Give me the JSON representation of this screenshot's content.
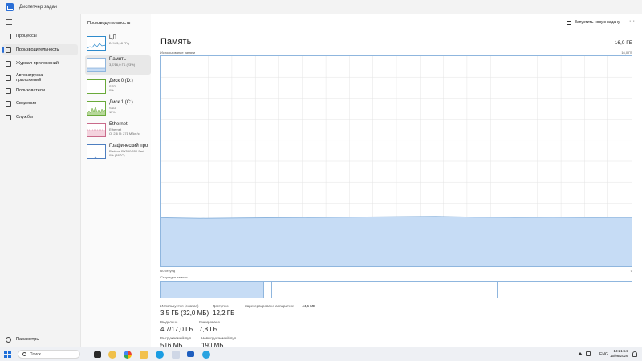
{
  "window": {
    "title": "Диспетчер задач"
  },
  "nav": {
    "items": [
      {
        "label": "Процессы"
      },
      {
        "label": "Производительность"
      },
      {
        "label": "Журнал приложений"
      },
      {
        "label": "Автозагрузка приложений"
      },
      {
        "label": "Пользователи"
      },
      {
        "label": "Сведения"
      },
      {
        "label": "Службы"
      }
    ],
    "settings": "Параметры"
  },
  "perf": {
    "header": "Производительность",
    "items": [
      {
        "name": "ЦП",
        "sub1": "24% 3,18 ГГц",
        "sub2": ""
      },
      {
        "name": "Память",
        "sub1": "3,7/16,0 ГБ (23%)",
        "sub2": ""
      },
      {
        "name": "Диск 0 (D:)",
        "sub1": "SSD",
        "sub2": "0%"
      },
      {
        "name": "Диск 1 (C:)",
        "sub1": "SSD",
        "sub2": "11%"
      },
      {
        "name": "Ethernet",
        "sub1": "Ethernet",
        "sub2": "О: 2,6 П: 271 Мбит/с"
      },
      {
        "name": "Графический про",
        "sub1": "Radeon RX550/550 Seri",
        "sub2": "0% (38 °C)"
      }
    ]
  },
  "main": {
    "run_task": "Запустить новую задачу",
    "more": "···",
    "title": "Память",
    "total": "16,0 ГБ",
    "usage_label": "Использование памяти",
    "usage_max": "16,0 ГБ",
    "axis_left": "60 секунд",
    "axis_right": "0",
    "struct_label": "Структура памяти",
    "stats": {
      "in_use_label": "Используется (сжатая)",
      "in_use_value": "3,5 ГБ (32,0 МБ)",
      "available_label": "Доступно",
      "available_value": "12,2 ГБ",
      "reserved_label": "Зарезервировано аппаратно:",
      "reserved_value": "44,6 МБ",
      "committed_label": "Выделено",
      "committed_value": "4,7/17,0 ГБ",
      "cached_label": "Кэшировано",
      "cached_value": "7,8 ГБ",
      "paged_label": "Выгружаемый пул",
      "paged_value": "516 МБ",
      "nonpaged_label": "Невыгружаемый пул",
      "nonpaged_value": "190 МБ"
    }
  },
  "taskbar": {
    "search_placeholder": "Поиск",
    "lang": "ENG",
    "time": "13:21:54",
    "date": "15/06/2026"
  },
  "chart_data": {
    "type": "area",
    "title": "Использование памяти",
    "xlabel": "",
    "ylabel": "",
    "xlim": [
      60,
      0
    ],
    "ylim": [
      0,
      16.0
    ],
    "x": [
      60,
      55,
      50,
      45,
      40,
      35,
      30,
      25,
      20,
      15,
      10,
      5,
      0
    ],
    "series": [
      {
        "values": [
          3.7,
          3.65,
          3.68,
          3.7,
          3.72,
          3.75,
          3.78,
          3.8,
          3.74,
          3.72,
          3.73,
          3.71,
          3.72
        ]
      }
    ],
    "grid": true,
    "colors": {
      "fill": "#c6dcf5",
      "line": "#8fb6de",
      "grid": "#e4e4e4"
    }
  }
}
